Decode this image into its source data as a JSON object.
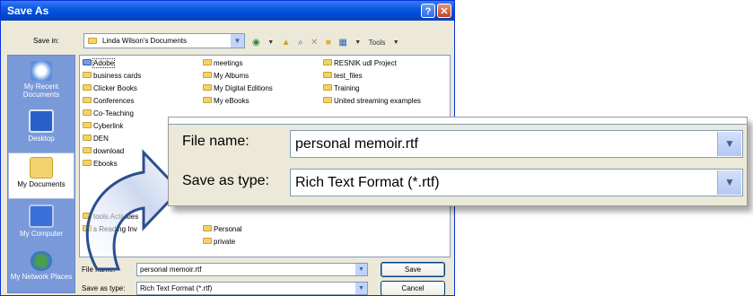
{
  "window": {
    "title": "Save As",
    "help_glyph": "?",
    "close_glyph": "✕"
  },
  "save_in": {
    "label": "Save in:",
    "value": "Linda Wilson's Documents"
  },
  "toolbar": {
    "tools_label": "Tools"
  },
  "places": [
    {
      "label": "My Recent Documents",
      "icon": "recent-documents-icon",
      "selected": false
    },
    {
      "label": "Desktop",
      "icon": "desktop-icon",
      "selected": false
    },
    {
      "label": "My Documents",
      "icon": "my-documents-icon",
      "selected": true
    },
    {
      "label": "My Computer",
      "icon": "my-computer-icon",
      "selected": false
    },
    {
      "label": "My Network Places",
      "icon": "network-places-icon",
      "selected": false
    }
  ],
  "files": {
    "col1": [
      "Adobe",
      "business cards",
      "Clicker Books",
      "Conferences",
      "Co-Teaching",
      "Cyberlink",
      "DEN",
      "download",
      "Ebooks"
    ],
    "col2": [
      "meetings",
      "My Albums",
      "My Digital Editions",
      "My eBooks"
    ],
    "col3": [
      "RESNIK udl Project",
      "test_files",
      "Training",
      "United streaming examples"
    ],
    "col1_tail": [
      "tools Activities",
      "s Reading Inv"
    ],
    "col2_tail": [
      "Personal",
      "private"
    ],
    "selected": "Adobe"
  },
  "file_name": {
    "label": "File name:",
    "value": "personal memoir.rtf"
  },
  "save_as_type": {
    "label": "Save as type:",
    "value": "Rich Text Format (*.rtf)"
  },
  "buttons": {
    "save": "Save",
    "cancel": "Cancel"
  },
  "zoom": {
    "file_name_label": "File name:",
    "file_name_value": "personal memoir.rtf",
    "save_as_type_label": "Save as type:",
    "save_as_type_value": "Rich Text Format (*.rtf)"
  },
  "colors": {
    "title_bar": "#0a58e0",
    "dialog_bg": "#ece9d8",
    "places_bar": "#7a99d8",
    "folder": "#f2d36b"
  }
}
